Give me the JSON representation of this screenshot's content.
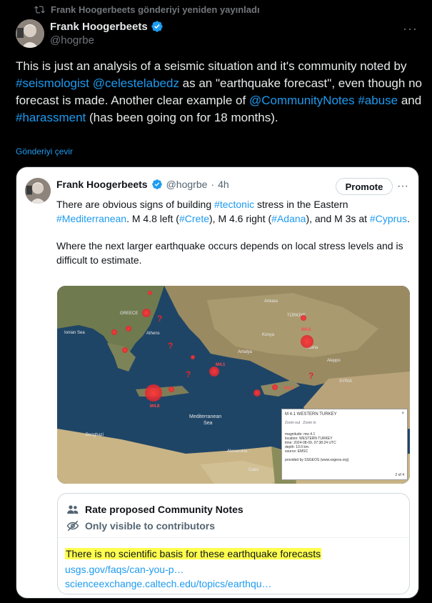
{
  "repost": {
    "text": "Frank Hoogerbeets gönderiyi yeniden yayınladı",
    "icon": "repost-icon"
  },
  "author": {
    "name": "Frank Hoogerbeets",
    "handle": "@hogrbe",
    "verified": true
  },
  "post": {
    "segments": [
      {
        "t": "This is just an analysis of a seismic situation and it's community noted by ",
        "link": false
      },
      {
        "t": "#seismologist",
        "link": true
      },
      {
        "t": " ",
        "link": false
      },
      {
        "t": "@celestelabedz",
        "link": true
      },
      {
        "t": " as an \"earthquake forecast\", even though no forecast is made. Another clear example of ",
        "link": false
      },
      {
        "t": "@CommunityNotes",
        "link": true
      },
      {
        "t": " ",
        "link": false
      },
      {
        "t": "#abuse",
        "link": true
      },
      {
        "t": " and ",
        "link": false
      },
      {
        "t": "#harassment",
        "link": true
      },
      {
        "t": " (has been going on for 18 months).",
        "link": false
      }
    ],
    "translate_label": "Gönderiyi çevir"
  },
  "quote": {
    "name": "Frank Hoogerbeets",
    "handle": "@hogrbe",
    "dot": "·",
    "time": "4h",
    "promote_label": "Promote",
    "paragraph1": [
      {
        "t": "There are obvious signs of building ",
        "link": false
      },
      {
        "t": "#tectonic",
        "link": true
      },
      {
        "t": " stress in the Eastern ",
        "link": false
      },
      {
        "t": "#Mediterranean",
        "link": true
      },
      {
        "t": ". M 4.8 left (",
        "link": false
      },
      {
        "t": "#Crete",
        "link": true
      },
      {
        "t": "), M 4.6 right (",
        "link": false
      },
      {
        "t": "#Adana",
        "link": true
      },
      {
        "t": "), and M 3s at ",
        "link": false
      },
      {
        "t": "#Cyprus",
        "link": true
      },
      {
        "t": ".",
        "link": false
      }
    ],
    "paragraph2": "Where the next larger earthquake occurs depends on local stress levels and is difficult to estimate."
  },
  "map": {
    "labels": {
      "greece": "GREECE",
      "athens": "Athens",
      "ankara": "Ankara",
      "turkey": "TÜRKİYE",
      "konya": "Konya",
      "antalya": "Antalya",
      "adana": "Adana",
      "aleppo": "Aleppo",
      "syria": "SYRIA",
      "med_sea_1": "Mediterranean",
      "med_sea_2": "Sea",
      "ionian_sea": "Ionian Sea",
      "benghazi": "Benghazi",
      "alexandria": "Alexandria",
      "cairo": "Cairo",
      "m48": "M4.8",
      "m46": "M4.6",
      "m41": "M4.1",
      "m42": "M4.2"
    },
    "popup": {
      "title": "M 4.1 WESTERN TURKEY",
      "tab1": "Zoom out",
      "tab2": "Zoom in",
      "lines": [
        "magnitude: mw 4.1",
        "location: WESTERN TURKEY",
        "time: 2024-08-09, 07:38:24 UTC",
        "depth: 10.0 km.",
        "source: EMSC"
      ],
      "footer": "provided by SSGEOS (www.ssgeos.org)",
      "pager": "2 of 4"
    }
  },
  "community_notes": {
    "header": "Rate proposed Community Notes",
    "visibility": "Only visible to contributors",
    "note_text": "There is no scientific basis for these earthquake forecasts",
    "link1": "usgs.gov/faqs/can-you-p…",
    "link2": "scienceexchange.caltech.edu/topics/earthqu…"
  },
  "colors": {
    "link": "#1d9bf0",
    "verified": "#1d9bf0",
    "highlight": "#ffff4d",
    "quake": "#e0262d"
  }
}
